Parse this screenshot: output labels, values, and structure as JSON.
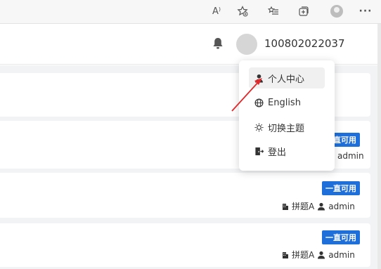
{
  "browser": {
    "read_aloud_label": "A⁾",
    "more_label": "···"
  },
  "header": {
    "username": "100802022037"
  },
  "menu": {
    "items": [
      {
        "label": "个人中心",
        "icon": "user-icon"
      },
      {
        "label": "English",
        "icon": "globe-icon"
      },
      {
        "label": "切换主题",
        "icon": "sun-icon"
      },
      {
        "label": "登出",
        "icon": "logout-icon"
      }
    ]
  },
  "cards": [
    {
      "tag": "一直可用",
      "meta_user": "admin"
    },
    {
      "tag": "一直可用",
      "meta_group": "拼题A",
      "meta_user": "admin"
    },
    {
      "tag": "一直可用",
      "meta_group": "拼题A",
      "meta_user": "admin"
    }
  ],
  "colors": {
    "tag": "#1e6fd9",
    "arrow": "#e0282a"
  }
}
